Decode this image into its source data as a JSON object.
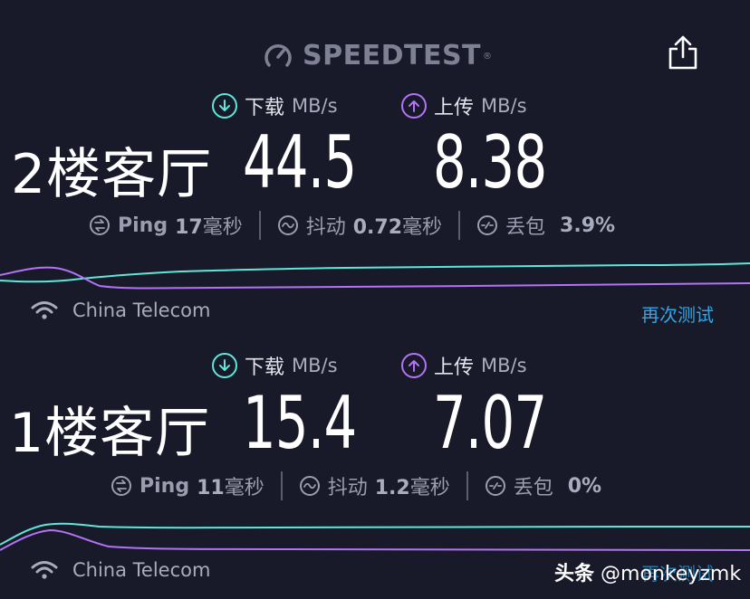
{
  "header": {
    "logo_text": "SPEEDTEST",
    "logo_tm": "®",
    "share_icon": "share-icon"
  },
  "results": [
    {
      "room": "2楼客厅",
      "download_label": "下载",
      "download_unit": "MB/s",
      "upload_label": "上传",
      "upload_unit": "MB/s",
      "download_value": "44.5",
      "upload_value": "8.38",
      "ping_label": "Ping",
      "ping_value": "17",
      "ping_unit": "毫秒",
      "jitter_label": "抖动",
      "jitter_value": "0.72",
      "jitter_unit": "毫秒",
      "loss_label": "丢包",
      "loss_value": "3.9%",
      "provider": "China Telecom",
      "retest": "再次测试"
    },
    {
      "room": "1楼客厅",
      "download_label": "下载",
      "download_unit": "MB/s",
      "upload_label": "上传",
      "upload_unit": "MB/s",
      "download_value": "15.4",
      "upload_value": "7.07",
      "ping_label": "Ping",
      "ping_value": "11",
      "ping_unit": "毫秒",
      "jitter_label": "抖动",
      "jitter_value": "1.2",
      "jitter_unit": "毫秒",
      "loss_label": "丢包",
      "loss_value": "0%",
      "provider": "China Telecom",
      "retest": "再次测试"
    }
  ],
  "watermark": {
    "brand": "头条",
    "handle": "@monkeyzmk"
  },
  "colors": {
    "background": "#181a2a",
    "download": "#5ee7d9",
    "upload": "#b472f4",
    "link": "#2ea6e8"
  }
}
